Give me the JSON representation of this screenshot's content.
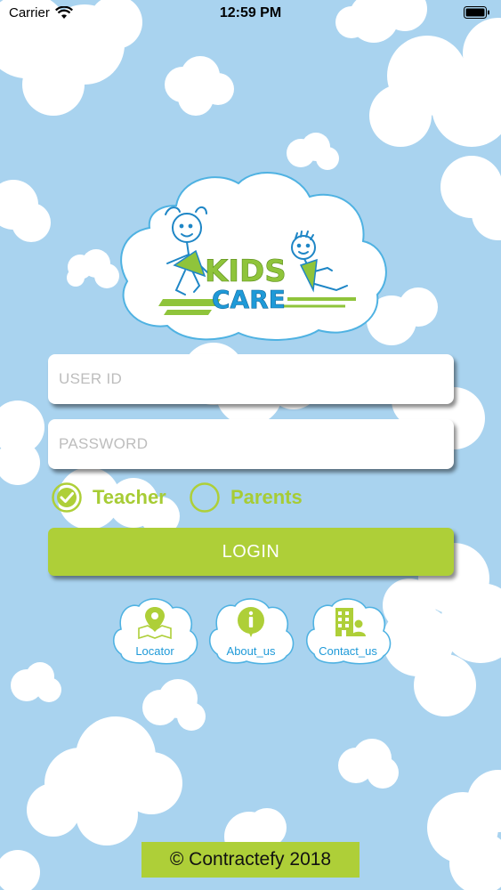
{
  "status_bar": {
    "carrier": "Carrier",
    "time": "12:59 PM"
  },
  "logo": {
    "line1": "KIDS",
    "line2": "CARE"
  },
  "login_form": {
    "user_id_placeholder": "USER ID",
    "password_placeholder": "PASSWORD",
    "role_options": [
      {
        "label": "Teacher",
        "selected": true
      },
      {
        "label": "Parents",
        "selected": false
      }
    ],
    "login_label": "LOGIN"
  },
  "quick_links": [
    {
      "label": "Locator",
      "icon": "map-pin-icon"
    },
    {
      "label": "About_us",
      "icon": "info-icon"
    },
    {
      "label": "Contact_us",
      "icon": "contact-building-icon"
    }
  ],
  "footer": {
    "text": "© Contractefy 2018"
  },
  "colors": {
    "sky": "#a9d3ef",
    "brand_green": "#aecf38",
    "brand_blue": "#1f9ad8"
  }
}
